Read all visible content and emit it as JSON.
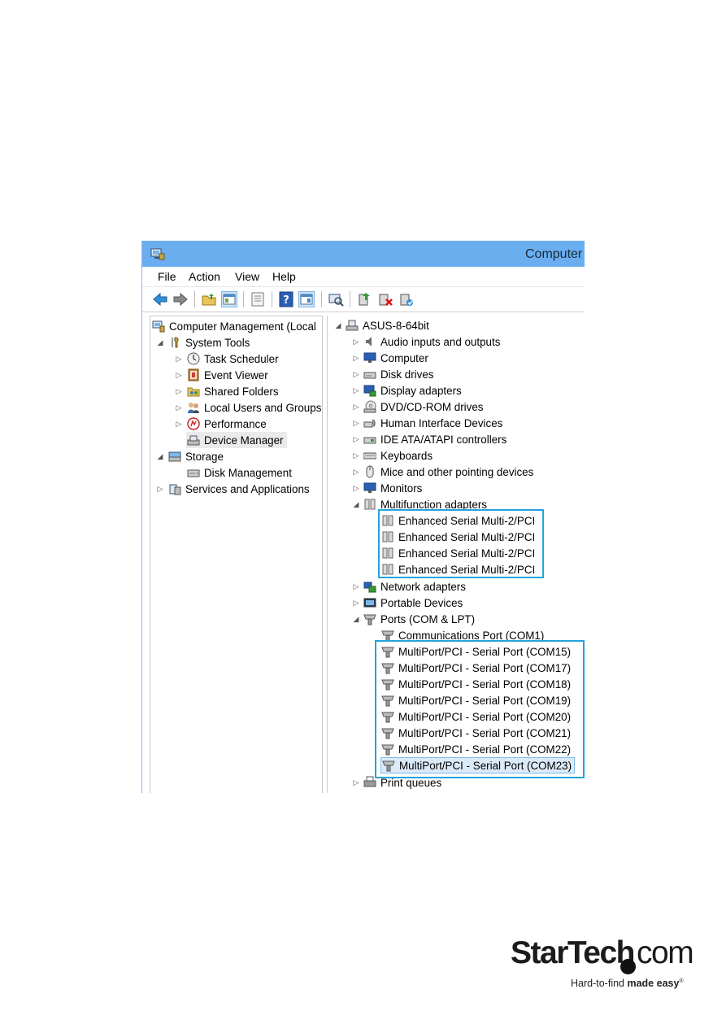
{
  "window": {
    "title": "Computer"
  },
  "menu": [
    "File",
    "Action",
    "View",
    "Help"
  ],
  "left_tree": [
    {
      "label": "Computer Management (Local",
      "icon": "computer-management-icon",
      "level": 0,
      "toggle": ""
    },
    {
      "label": "System Tools",
      "icon": "tools-icon",
      "level": 1,
      "toggle": "expanded"
    },
    {
      "label": "Task Scheduler",
      "icon": "clock-icon",
      "level": 2,
      "toggle": "collapsed"
    },
    {
      "label": "Event Viewer",
      "icon": "event-viewer-icon",
      "level": 2,
      "toggle": "collapsed"
    },
    {
      "label": "Shared Folders",
      "icon": "shared-folder-icon",
      "level": 2,
      "toggle": "collapsed"
    },
    {
      "label": "Local Users and Groups",
      "icon": "users-icon",
      "level": 2,
      "toggle": "collapsed"
    },
    {
      "label": "Performance",
      "icon": "performance-icon",
      "level": 2,
      "toggle": "collapsed"
    },
    {
      "label": "Device Manager",
      "icon": "device-manager-icon",
      "level": 2,
      "toggle": "",
      "selected": true
    },
    {
      "label": "Storage",
      "icon": "storage-icon",
      "level": 1,
      "toggle": "expanded"
    },
    {
      "label": "Disk Management",
      "icon": "disk-icon",
      "level": 2,
      "toggle": ""
    },
    {
      "label": "Services and Applications",
      "icon": "services-icon",
      "level": 1,
      "toggle": "collapsed"
    }
  ],
  "right_tree": [
    {
      "label": "ASUS-8-64bit",
      "icon": "computer-icon",
      "level": 0,
      "toggle": "expanded"
    },
    {
      "label": "Audio inputs and outputs",
      "icon": "speaker-icon",
      "level": 1,
      "toggle": "collapsed"
    },
    {
      "label": "Computer",
      "icon": "monitor-icon",
      "level": 1,
      "toggle": "collapsed"
    },
    {
      "label": "Disk drives",
      "icon": "disk-drive-icon",
      "level": 1,
      "toggle": "collapsed"
    },
    {
      "label": "Display adapters",
      "icon": "display-adapter-icon",
      "level": 1,
      "toggle": "collapsed"
    },
    {
      "label": "DVD/CD-ROM drives",
      "icon": "dvd-icon",
      "level": 1,
      "toggle": "collapsed"
    },
    {
      "label": "Human Interface Devices",
      "icon": "hid-icon",
      "level": 1,
      "toggle": "collapsed"
    },
    {
      "label": "IDE ATA/ATAPI controllers",
      "icon": "ide-icon",
      "level": 1,
      "toggle": "collapsed"
    },
    {
      "label": "Keyboards",
      "icon": "keyboard-icon",
      "level": 1,
      "toggle": "collapsed"
    },
    {
      "label": "Mice and other pointing devices",
      "icon": "mouse-icon",
      "level": 1,
      "toggle": "collapsed"
    },
    {
      "label": "Monitors",
      "icon": "monitor-icon",
      "level": 1,
      "toggle": "collapsed"
    },
    {
      "label": "Multifunction adapters",
      "icon": "multifunction-adapter-icon",
      "level": 1,
      "toggle": "expanded"
    },
    {
      "label": "Enhanced Serial Multi-2/PCI",
      "icon": "multifunction-adapter-icon",
      "level": 2,
      "toggle": ""
    },
    {
      "label": "Enhanced Serial Multi-2/PCI",
      "icon": "multifunction-adapter-icon",
      "level": 2,
      "toggle": ""
    },
    {
      "label": "Enhanced Serial Multi-2/PCI",
      "icon": "multifunction-adapter-icon",
      "level": 2,
      "toggle": ""
    },
    {
      "label": "Enhanced Serial Multi-2/PCI",
      "icon": "multifunction-adapter-icon",
      "level": 2,
      "toggle": ""
    },
    {
      "label": "Network adapters",
      "icon": "network-icon",
      "level": 1,
      "toggle": "collapsed"
    },
    {
      "label": "Portable Devices",
      "icon": "portable-device-icon",
      "level": 1,
      "toggle": "collapsed"
    },
    {
      "label": "Ports (COM & LPT)",
      "icon": "port-icon",
      "level": 1,
      "toggle": "expanded"
    },
    {
      "label": "Communications Port (COM1)",
      "icon": "port-icon",
      "level": 2,
      "toggle": ""
    },
    {
      "label": "MultiPort/PCI - Serial Port (COM15)",
      "icon": "port-icon",
      "level": 2,
      "toggle": ""
    },
    {
      "label": "MultiPort/PCI - Serial Port (COM17)",
      "icon": "port-icon",
      "level": 2,
      "toggle": ""
    },
    {
      "label": "MultiPort/PCI - Serial Port (COM18)",
      "icon": "port-icon",
      "level": 2,
      "toggle": ""
    },
    {
      "label": "MultiPort/PCI - Serial Port (COM19)",
      "icon": "port-icon",
      "level": 2,
      "toggle": ""
    },
    {
      "label": "MultiPort/PCI - Serial Port (COM20)",
      "icon": "port-icon",
      "level": 2,
      "toggle": ""
    },
    {
      "label": "MultiPort/PCI - Serial Port (COM21)",
      "icon": "port-icon",
      "level": 2,
      "toggle": ""
    },
    {
      "label": "MultiPort/PCI - Serial Port (COM22)",
      "icon": "port-icon",
      "level": 2,
      "toggle": ""
    },
    {
      "label": "MultiPort/PCI - Serial Port (COM23)",
      "icon": "port-icon",
      "level": 2,
      "toggle": "",
      "focused": true
    },
    {
      "label": "Print queues",
      "icon": "printer-icon",
      "level": 1,
      "toggle": "collapsed"
    }
  ],
  "logo": {
    "brand": "StarTech",
    "com": "com",
    "tagline_plain": "Hard-to-find ",
    "tagline_bold": "made easy",
    "tagline_mark": "®"
  },
  "colors": {
    "titlebar": "#6aaef0",
    "highlight_box": "#23a4dc",
    "selected_row": "#eaeaea",
    "focused_row": "#dbeaf8"
  }
}
